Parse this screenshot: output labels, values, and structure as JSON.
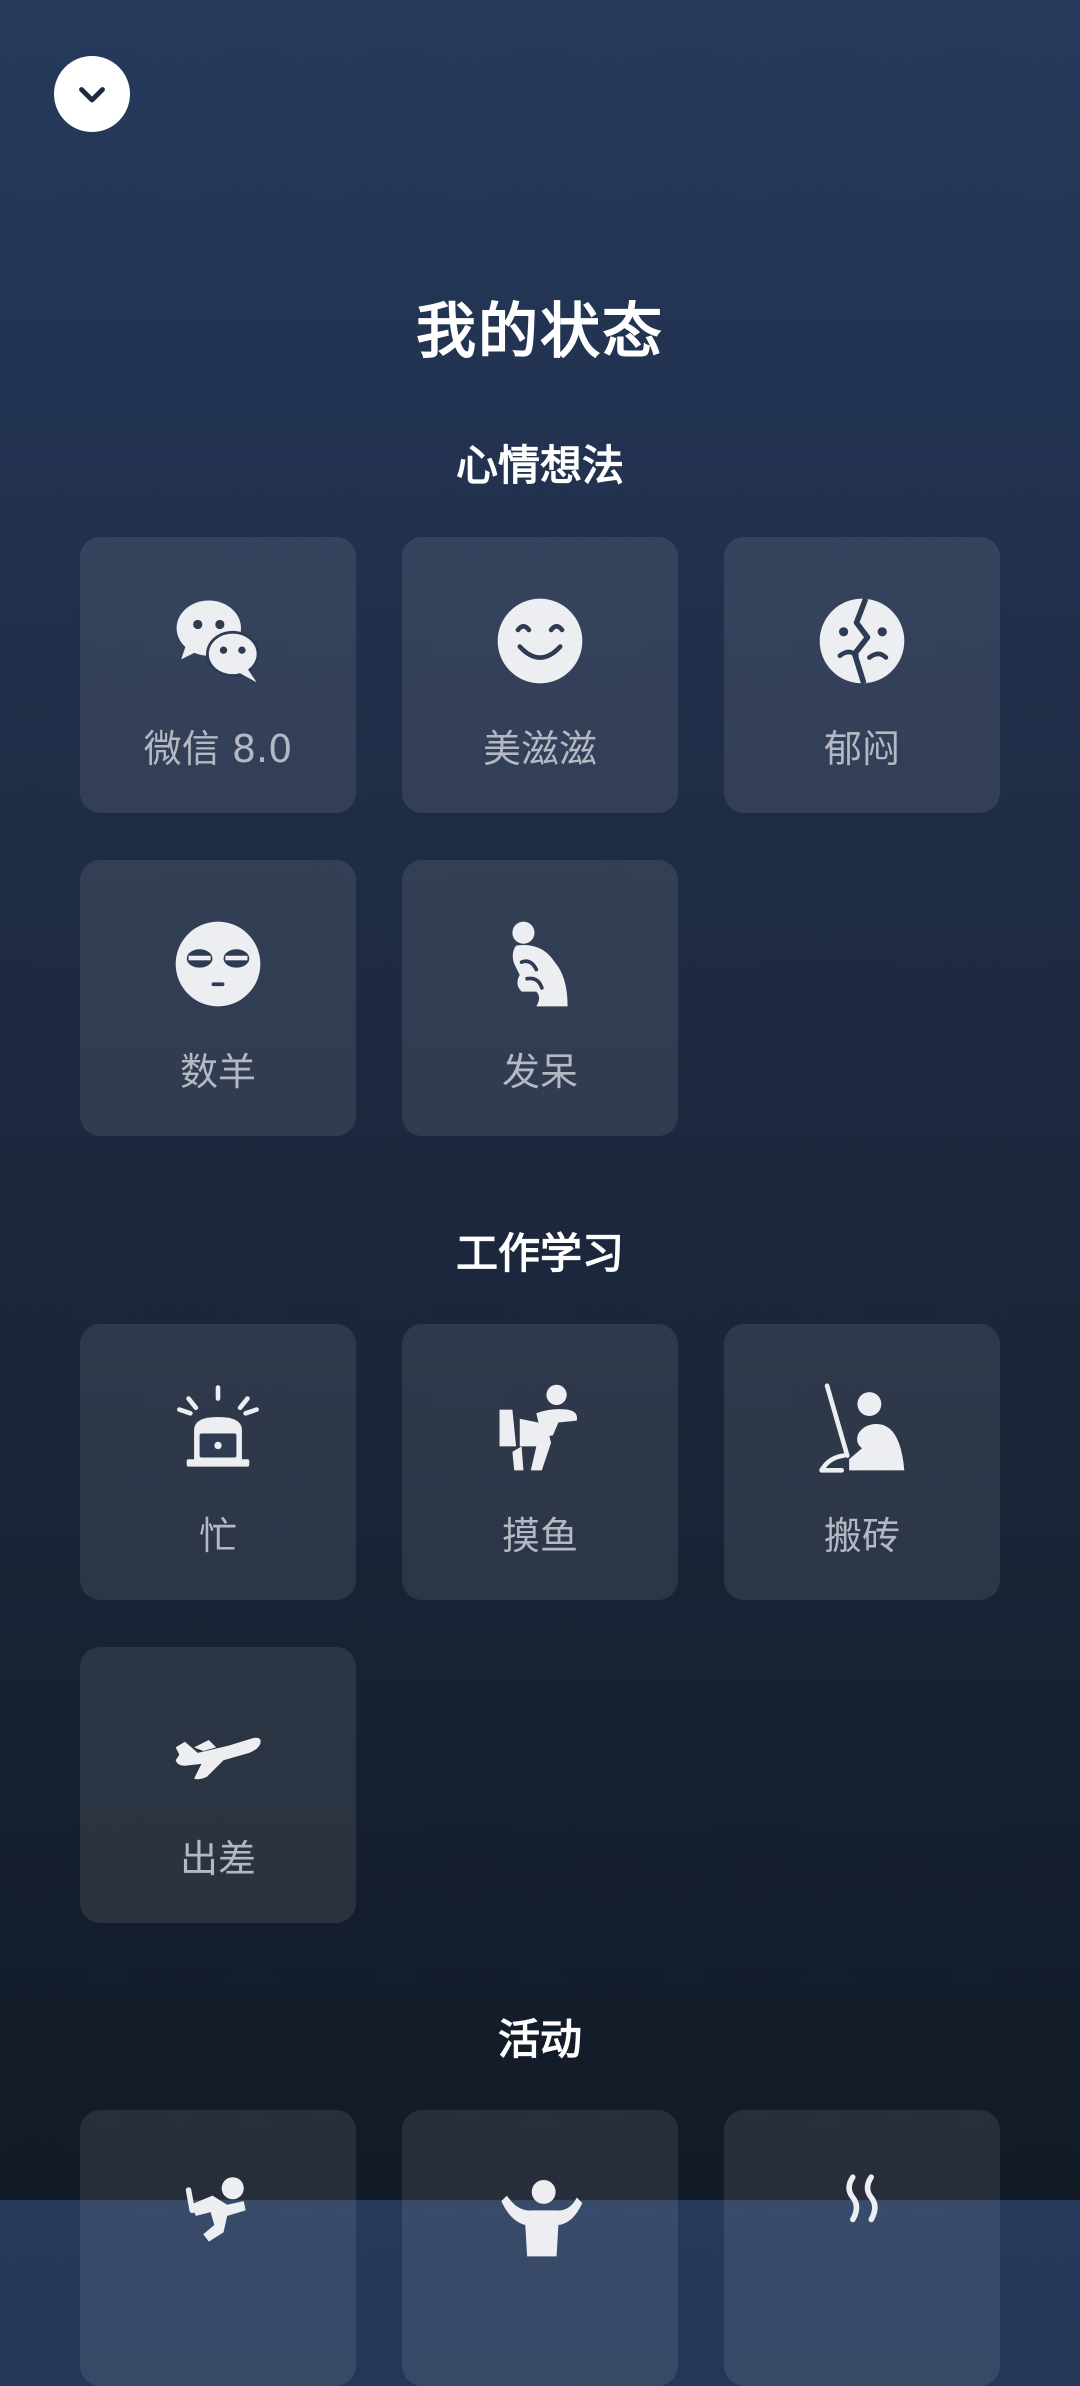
{
  "header": {
    "title": "我的状态"
  },
  "sections": [
    {
      "title": "心情想法",
      "items": [
        {
          "label": "微信 8.0",
          "icon": "wechat-icon"
        },
        {
          "label": "美滋滋",
          "icon": "smile-face-icon"
        },
        {
          "label": "郁闷",
          "icon": "broken-face-icon"
        },
        {
          "label": "数羊",
          "icon": "sleepy-face-icon"
        },
        {
          "label": "发呆",
          "icon": "thinker-icon"
        }
      ]
    },
    {
      "title": "工作学习",
      "items": [
        {
          "label": "忙",
          "icon": "busy-laptop-icon"
        },
        {
          "label": "摸鱼",
          "icon": "slacking-person-icon"
        },
        {
          "label": "搬砖",
          "icon": "worker-person-icon"
        },
        {
          "label": "出差",
          "icon": "airplane-icon"
        }
      ]
    },
    {
      "title": "活动",
      "items": [
        {
          "label": "",
          "icon": "running-person-icon"
        },
        {
          "label": "",
          "icon": "cheering-person-icon"
        },
        {
          "label": "",
          "icon": "steam-icon"
        }
      ]
    }
  ],
  "colors": {
    "background_top": "#263a5c",
    "background_bottom": "#121a26",
    "tile_bg": "rgba(255,255,255,0.09)",
    "label": "#b3b8c2",
    "icon": "#eceef2"
  }
}
